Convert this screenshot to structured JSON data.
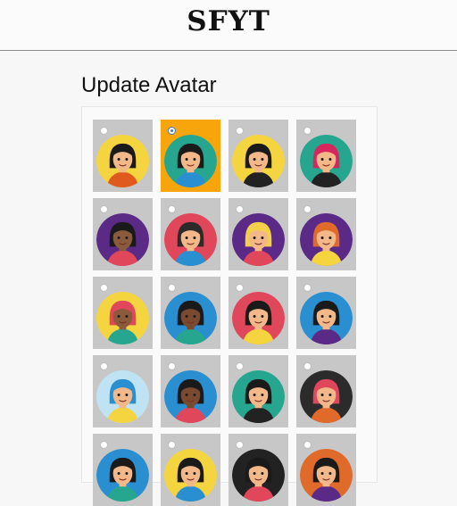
{
  "header": {
    "logo_text": "SFYT"
  },
  "page": {
    "title": "Update Avatar"
  },
  "avatars": [
    {
      "bg": "#f5d53f",
      "hair": "#1a1a1a",
      "skin": "#f3b88a",
      "shirt": "#e05a1e",
      "selected": false,
      "icon": "woman-bob-avatar-icon"
    },
    {
      "bg": "#27a68f",
      "hair": "#1a1a1a",
      "skin": "#f3b88a",
      "shirt": "#2a8fd1",
      "selected": true,
      "icon": "woman-dark-hair-avatar-icon"
    },
    {
      "bg": "#f5d53f",
      "hair": "#1a1a1a",
      "skin": "#f3b88a",
      "shirt": "#222222",
      "selected": false,
      "icon": "man-black-hair-avatar-icon"
    },
    {
      "bg": "#27a68f",
      "hair": "#d6275c",
      "skin": "#f3b88a",
      "shirt": "#222222",
      "selected": false,
      "icon": "woman-pink-hair-avatar-icon"
    },
    {
      "bg": "#5b2a86",
      "hair": "#1a1a1a",
      "skin": "#8a5a3c",
      "shirt": "#e0475b",
      "selected": false,
      "icon": "woman-braids-avatar-icon"
    },
    {
      "bg": "#e0475b",
      "hair": "#2b2b2b",
      "skin": "#f3b88a",
      "shirt": "#2a8fd1",
      "selected": false,
      "icon": "man-beard-avatar-icon"
    },
    {
      "bg": "#5b2a86",
      "hair": "#f4d04a",
      "skin": "#f3b88a",
      "shirt": "#e0475b",
      "selected": false,
      "icon": "woman-blonde-avatar-icon"
    },
    {
      "bg": "#5b2a86",
      "hair": "#e06a2a",
      "skin": "#f3b88a",
      "shirt": "#f5d53f",
      "selected": false,
      "icon": "man-ginger-avatar-icon"
    },
    {
      "bg": "#f5d53f",
      "hair": "#e0475b",
      "skin": "#8a5a3c",
      "shirt": "#27a68f",
      "selected": false,
      "icon": "man-cap-avatar-icon"
    },
    {
      "bg": "#2a8fd1",
      "hair": "#1a1a1a",
      "skin": "#7a4a30",
      "shirt": "#27a68f",
      "selected": false,
      "icon": "woman-necklace-avatar-icon"
    },
    {
      "bg": "#e0475b",
      "hair": "#1a1a1a",
      "skin": "#f3b88a",
      "shirt": "#f5d53f",
      "selected": false,
      "icon": "woman-bun-avatar-icon"
    },
    {
      "bg": "#2a8fd1",
      "hair": "#1a1a1a",
      "skin": "#f3b88a",
      "shirt": "#5b2a86",
      "selected": false,
      "icon": "man-topknot-avatar-icon"
    },
    {
      "bg": "#bfe3f2",
      "hair": "#2a8fd1",
      "skin": "#f3b88a",
      "shirt": "#f5d53f",
      "selected": false,
      "icon": "woman-blue-buns-avatar-icon"
    },
    {
      "bg": "#2a8fd1",
      "hair": "#1a1a1a",
      "skin": "#7a4a30",
      "shirt": "#e0475b",
      "selected": false,
      "icon": "man-dark-beard-avatar-icon"
    },
    {
      "bg": "#27a68f",
      "hair": "#1a1a1a",
      "skin": "#f3b88a",
      "shirt": "#222222",
      "selected": false,
      "icon": "man-tuxedo-avatar-icon"
    },
    {
      "bg": "#2b2b2b",
      "hair": "#e0475b",
      "skin": "#f3b88a",
      "shirt": "#e06a2a",
      "selected": false,
      "icon": "man-red-spiky-hair-avatar-icon"
    },
    {
      "bg": "#2a8fd1",
      "hair": "#1a1a1a",
      "skin": "#f3b88a",
      "shirt": "#27a68f",
      "selected": false,
      "icon": "avatar-icon"
    },
    {
      "bg": "#f5d53f",
      "hair": "#1a1a1a",
      "skin": "#f3b88a",
      "shirt": "#2a8fd1",
      "selected": false,
      "icon": "avatar-icon"
    },
    {
      "bg": "#222222",
      "hair": "#1a1a1a",
      "skin": "#f3b88a",
      "shirt": "#e0475b",
      "selected": false,
      "icon": "avatar-icon"
    },
    {
      "bg": "#e06a2a",
      "hair": "#1a1a1a",
      "skin": "#f3b88a",
      "shirt": "#5b2a86",
      "selected": false,
      "icon": "avatar-icon"
    }
  ]
}
